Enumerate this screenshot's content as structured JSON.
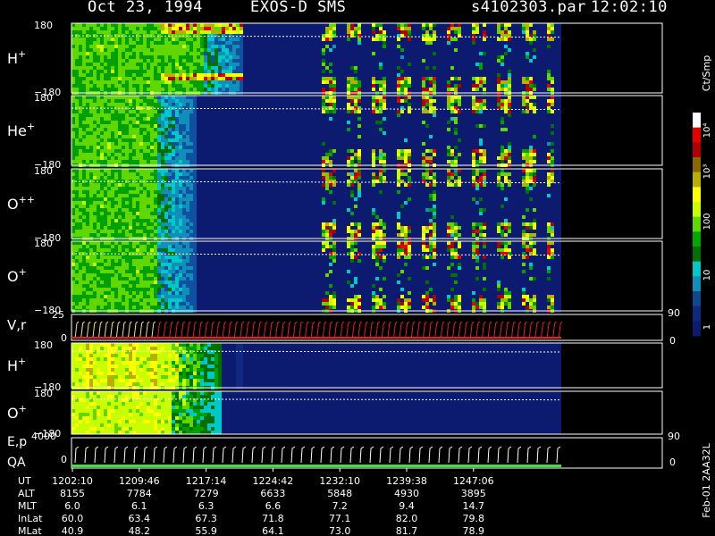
{
  "header": {
    "date": "Oct 23, 1994",
    "instrument": "EXOS-D SMS",
    "file": "s4102303.par",
    "time": "12:02:10"
  },
  "side_note": "Feb-01 2AA32L",
  "colorbar": {
    "title": "Ct/Smp",
    "ticks": [
      "10⁴",
      "10³",
      "100",
      "10",
      "1"
    ],
    "colors": [
      "#ffffff",
      "#e80000",
      "#b00000",
      "#8a6a00",
      "#b8b000",
      "#ffff00",
      "#c8ff00",
      "#60d800",
      "#00a800",
      "#007000",
      "#00c8c8",
      "#1090b8",
      "#104890",
      "#102880",
      "#0c1a70"
    ]
  },
  "chart_data": {
    "type": "heatmap",
    "x_axis": {
      "label": "UT",
      "ticks": [
        "1202:10",
        "1209:46",
        "1217:14",
        "1224:42",
        "1232:10",
        "1239:38",
        "1247:06"
      ]
    },
    "panels": [
      {
        "name": "H⁺",
        "superscript": "+",
        "base": "H",
        "ylim": [
          -180,
          180
        ],
        "ytop": "180",
        "ybot": "−180"
      },
      {
        "name": "He⁺",
        "base": "He",
        "superscript": "+",
        "ylim": [
          -180,
          180
        ],
        "ytop": "180",
        "ybot": "−180"
      },
      {
        "name": "O⁺⁺",
        "base": "O",
        "superscript": "++",
        "ylim": [
          -180,
          180
        ],
        "ytop": "180",
        "ybot": "−180"
      },
      {
        "name": "O⁺",
        "base": "O",
        "superscript": "+",
        "ylim": [
          -180,
          180
        ],
        "ytop": "180",
        "ybot": "−180"
      },
      {
        "name": "V,r",
        "type": "line",
        "left_range": [
          "25",
          "0"
        ],
        "right_range": [
          "90",
          "0"
        ]
      },
      {
        "name": "H⁺",
        "base": "H",
        "superscript": "+",
        "ylim": [
          -180,
          180
        ],
        "ytop": "180",
        "ybot": "−180"
      },
      {
        "name": "O⁺",
        "base": "O",
        "superscript": "+",
        "ylim": [
          -180,
          180
        ],
        "ytop": "180",
        "ybot": "−180"
      },
      {
        "name": "E,p / QA",
        "type": "line",
        "label1": "E,p",
        "label2": "QA",
        "left_range": [
          "4000",
          "0"
        ],
        "right_range": [
          "90",
          "0"
        ]
      }
    ],
    "ephemeris": {
      "rows": [
        {
          "label": "UT",
          "values": [
            "1202:10",
            "1209:46",
            "1217:14",
            "1224:42",
            "1232:10",
            "1239:38",
            "1247:06"
          ]
        },
        {
          "label": "ALT",
          "values": [
            "8155",
            "7784",
            "7279",
            "6633",
            "5848",
            "4930",
            "3895"
          ]
        },
        {
          "label": "MLT",
          "values": [
            "6.0",
            "6.1",
            "6.3",
            "6.6",
            "7.2",
            "9.4",
            "14.7"
          ]
        },
        {
          "label": "InLat",
          "values": [
            "60.0",
            "63.4",
            "67.3",
            "71.8",
            "77.1",
            "82.0",
            "79.8"
          ]
        },
        {
          "label": "MLat",
          "values": [
            "40.9",
            "48.2",
            "55.9",
            "64.1",
            "73.0",
            "81.7",
            "78.9"
          ]
        }
      ]
    }
  }
}
